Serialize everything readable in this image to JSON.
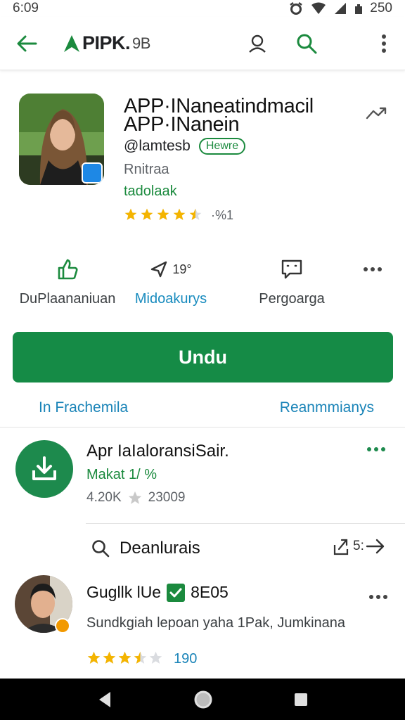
{
  "status_bar": {
    "time": "6:09",
    "battery": "250"
  },
  "app_bar": {
    "brand_main": "PIPK.",
    "brand_sub": "9B"
  },
  "app": {
    "title_line1": "APP·INaneatindmacil",
    "title_line2": "APP·INanein",
    "developer": "@lamtesb",
    "badge": "Hewre",
    "category": "Rnitraa",
    "contains": "tadolaak",
    "rating_value": 4.5,
    "rating_text": "·%1"
  },
  "actions": [
    {
      "label": "DuPlaananiuan",
      "icon": "thumb-up-icon",
      "extra": ""
    },
    {
      "label": "Midoakurys",
      "icon": "send-icon",
      "extra": "19°"
    },
    {
      "label": "Pergoarga",
      "icon": "message-icon",
      "extra": ""
    },
    {
      "label": "",
      "icon": "more-icon",
      "extra": ""
    }
  ],
  "install_button": "Undu",
  "links": {
    "left": "In Frachemila",
    "right": "Reanmmianys"
  },
  "related": {
    "title": "Apr IaIaloransiSair.",
    "subtitle": "Makat 1/ %",
    "downloads": "4.20K",
    "count": "23009"
  },
  "search_row": {
    "label": "Deanlurais",
    "share_count": "5:"
  },
  "review": {
    "name": "Gugllk lUe",
    "code": "8E05",
    "text": "Sundkgiah lepoan yaha 1Pak, Jumkinana",
    "rating_value": 3.5,
    "count": "190"
  },
  "colors": {
    "accent_green": "#158b46",
    "link_blue": "#1a84b8",
    "star": "#f4b400"
  }
}
